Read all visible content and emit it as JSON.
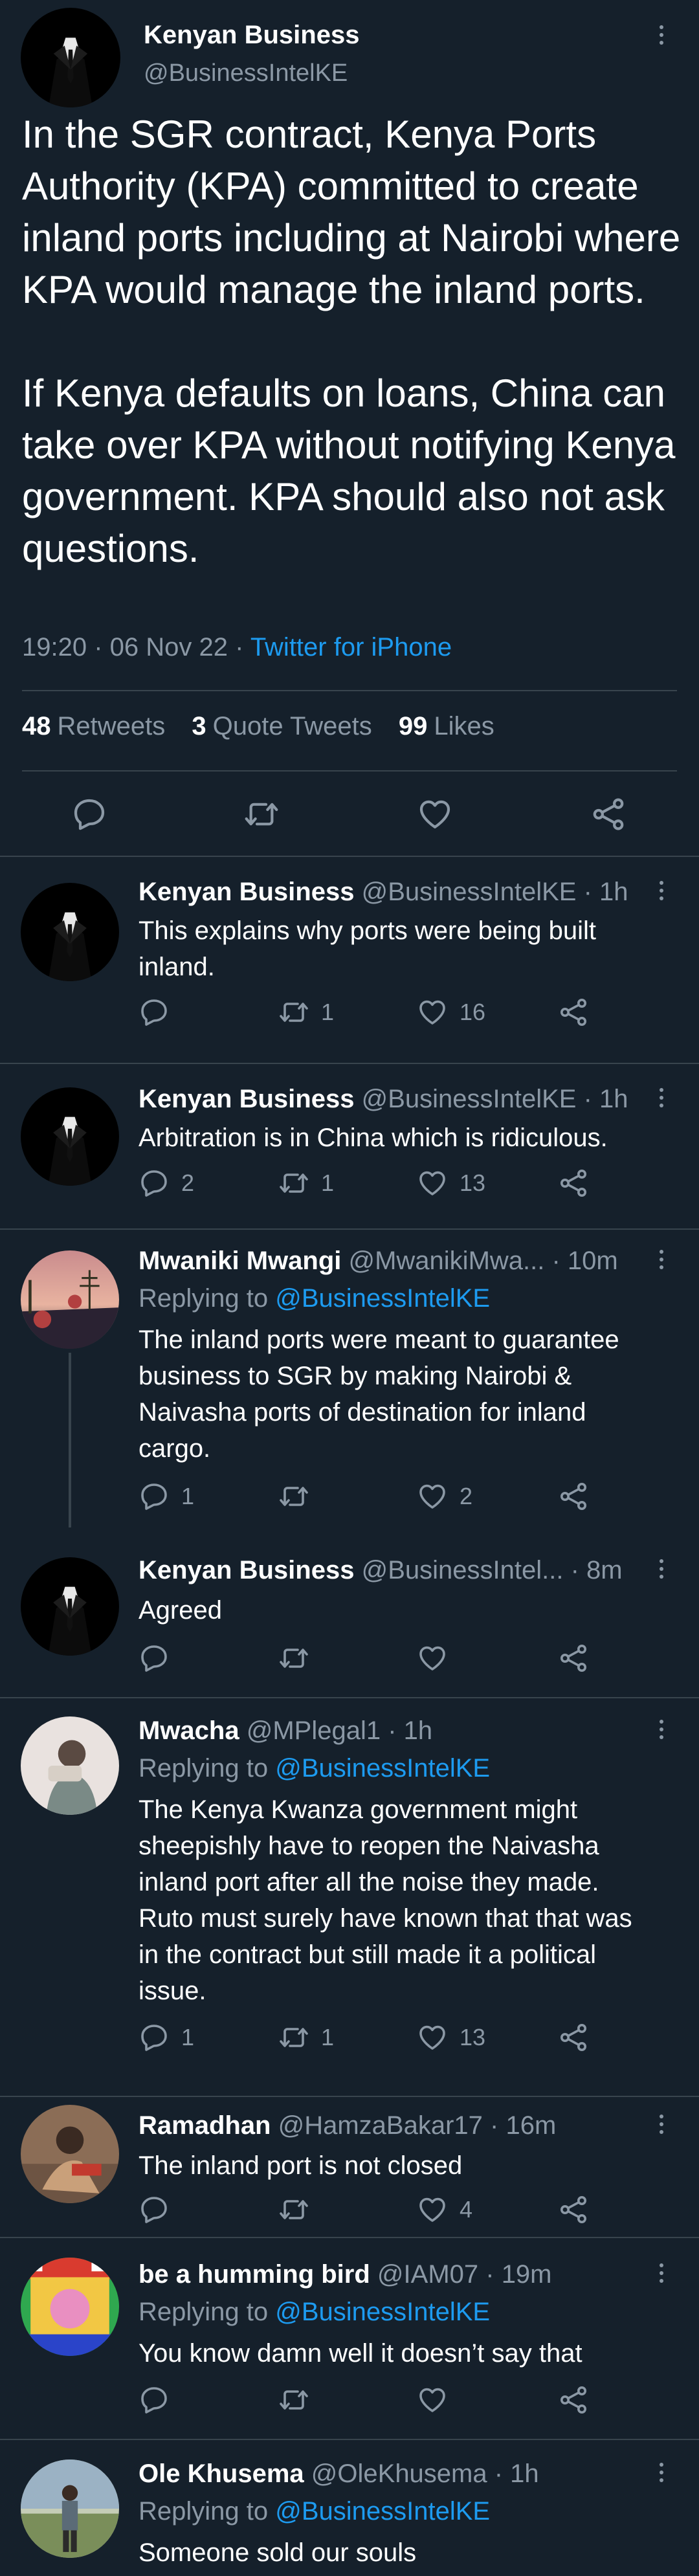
{
  "main_tweet": {
    "author_name": "Kenyan Business",
    "author_handle": "@BusinessIntelKE",
    "text": "In the SGR contract, Kenya Ports Authority (KPA) committed to create inland ports including at Nairobi where KPA would manage the inland ports.\n\nIf Kenya defaults on loans, China can take over KPA without notifying Kenya government. KPA should also not ask questions.",
    "time": "19:20 · 06 Nov 22 · ",
    "source": "Twitter for iPhone",
    "stats": {
      "retweets_count": "48",
      "retweets_label": "Retweets",
      "quotes_count": "3",
      "quotes_label": "Quote Tweets",
      "likes_count": "99",
      "likes_label": "Likes"
    }
  },
  "replies": [
    {
      "name": "Kenyan Business",
      "handle": "@BusinessIntelKE",
      "time": " · 1h",
      "replying_label": "",
      "replying_to": "",
      "text": "This explains why ports were being built inland.",
      "replies": "",
      "retweets": "1",
      "likes": "16"
    },
    {
      "name": "Kenyan Business",
      "handle": "@BusinessIntelKE",
      "time": " · 1h",
      "replying_label": "",
      "replying_to": "",
      "text": "Arbitration is in China which is ridiculous.",
      "replies": "2",
      "retweets": "1",
      "likes": "13"
    },
    {
      "name": "Mwaniki Mwangi",
      "handle": "@MwanikiMwa...",
      "time": " · 10m",
      "replying_label": "Replying to ",
      "replying_to": "@BusinessIntelKE",
      "text": "The inland ports were meant to guarantee business to SGR by making Nairobi & Naivasha ports of destination for inland cargo.",
      "replies": "1",
      "retweets": "",
      "likes": "2"
    },
    {
      "name": "Kenyan Business",
      "handle": "@BusinessIntel...",
      "time": " · 8m",
      "replying_label": "",
      "replying_to": "",
      "text": "Agreed",
      "replies": "",
      "retweets": "",
      "likes": ""
    },
    {
      "name": "Mwacha",
      "handle": "@MPlegal1",
      "time": " · 1h",
      "replying_label": "Replying to ",
      "replying_to": "@BusinessIntelKE",
      "text": "The Kenya Kwanza government might sheepishly have to reopen the Naivasha inland port after all the noise they made. Ruto must surely have known that that was in the contract but still made it a political issue.",
      "replies": "1",
      "retweets": "1",
      "likes": "13"
    },
    {
      "name": "Ramadhan",
      "handle": "@HamzaBakar17",
      "time": " · 16m",
      "replying_label": "",
      "replying_to": "",
      "text": "The inland port is not closed",
      "replies": "",
      "retweets": "",
      "likes": "4"
    },
    {
      "name": "be a humming bird",
      "handle": "@IAM07",
      "time": " · 19m",
      "replying_label": "Replying to ",
      "replying_to": "@BusinessIntelKE",
      "text": "You know damn well it doesn’t say that",
      "replies": "",
      "retweets": "",
      "likes": ""
    },
    {
      "name": "Ole Khusema",
      "handle": "@OleKhusema",
      "time": " · 1h",
      "replying_label": "Replying to ",
      "replying_to": "@BusinessIntelKE",
      "text": "Someone sold our souls",
      "replies": "",
      "retweets": "",
      "likes": ""
    }
  ],
  "colors": {
    "background": "#15202b",
    "text_primary": "#ffffff",
    "text_muted": "#8b98a5",
    "link": "#1d9bf0",
    "divider": "#38444d"
  },
  "icons": [
    "more-icon",
    "reply-icon",
    "retweet-icon",
    "like-icon",
    "share-icon"
  ]
}
